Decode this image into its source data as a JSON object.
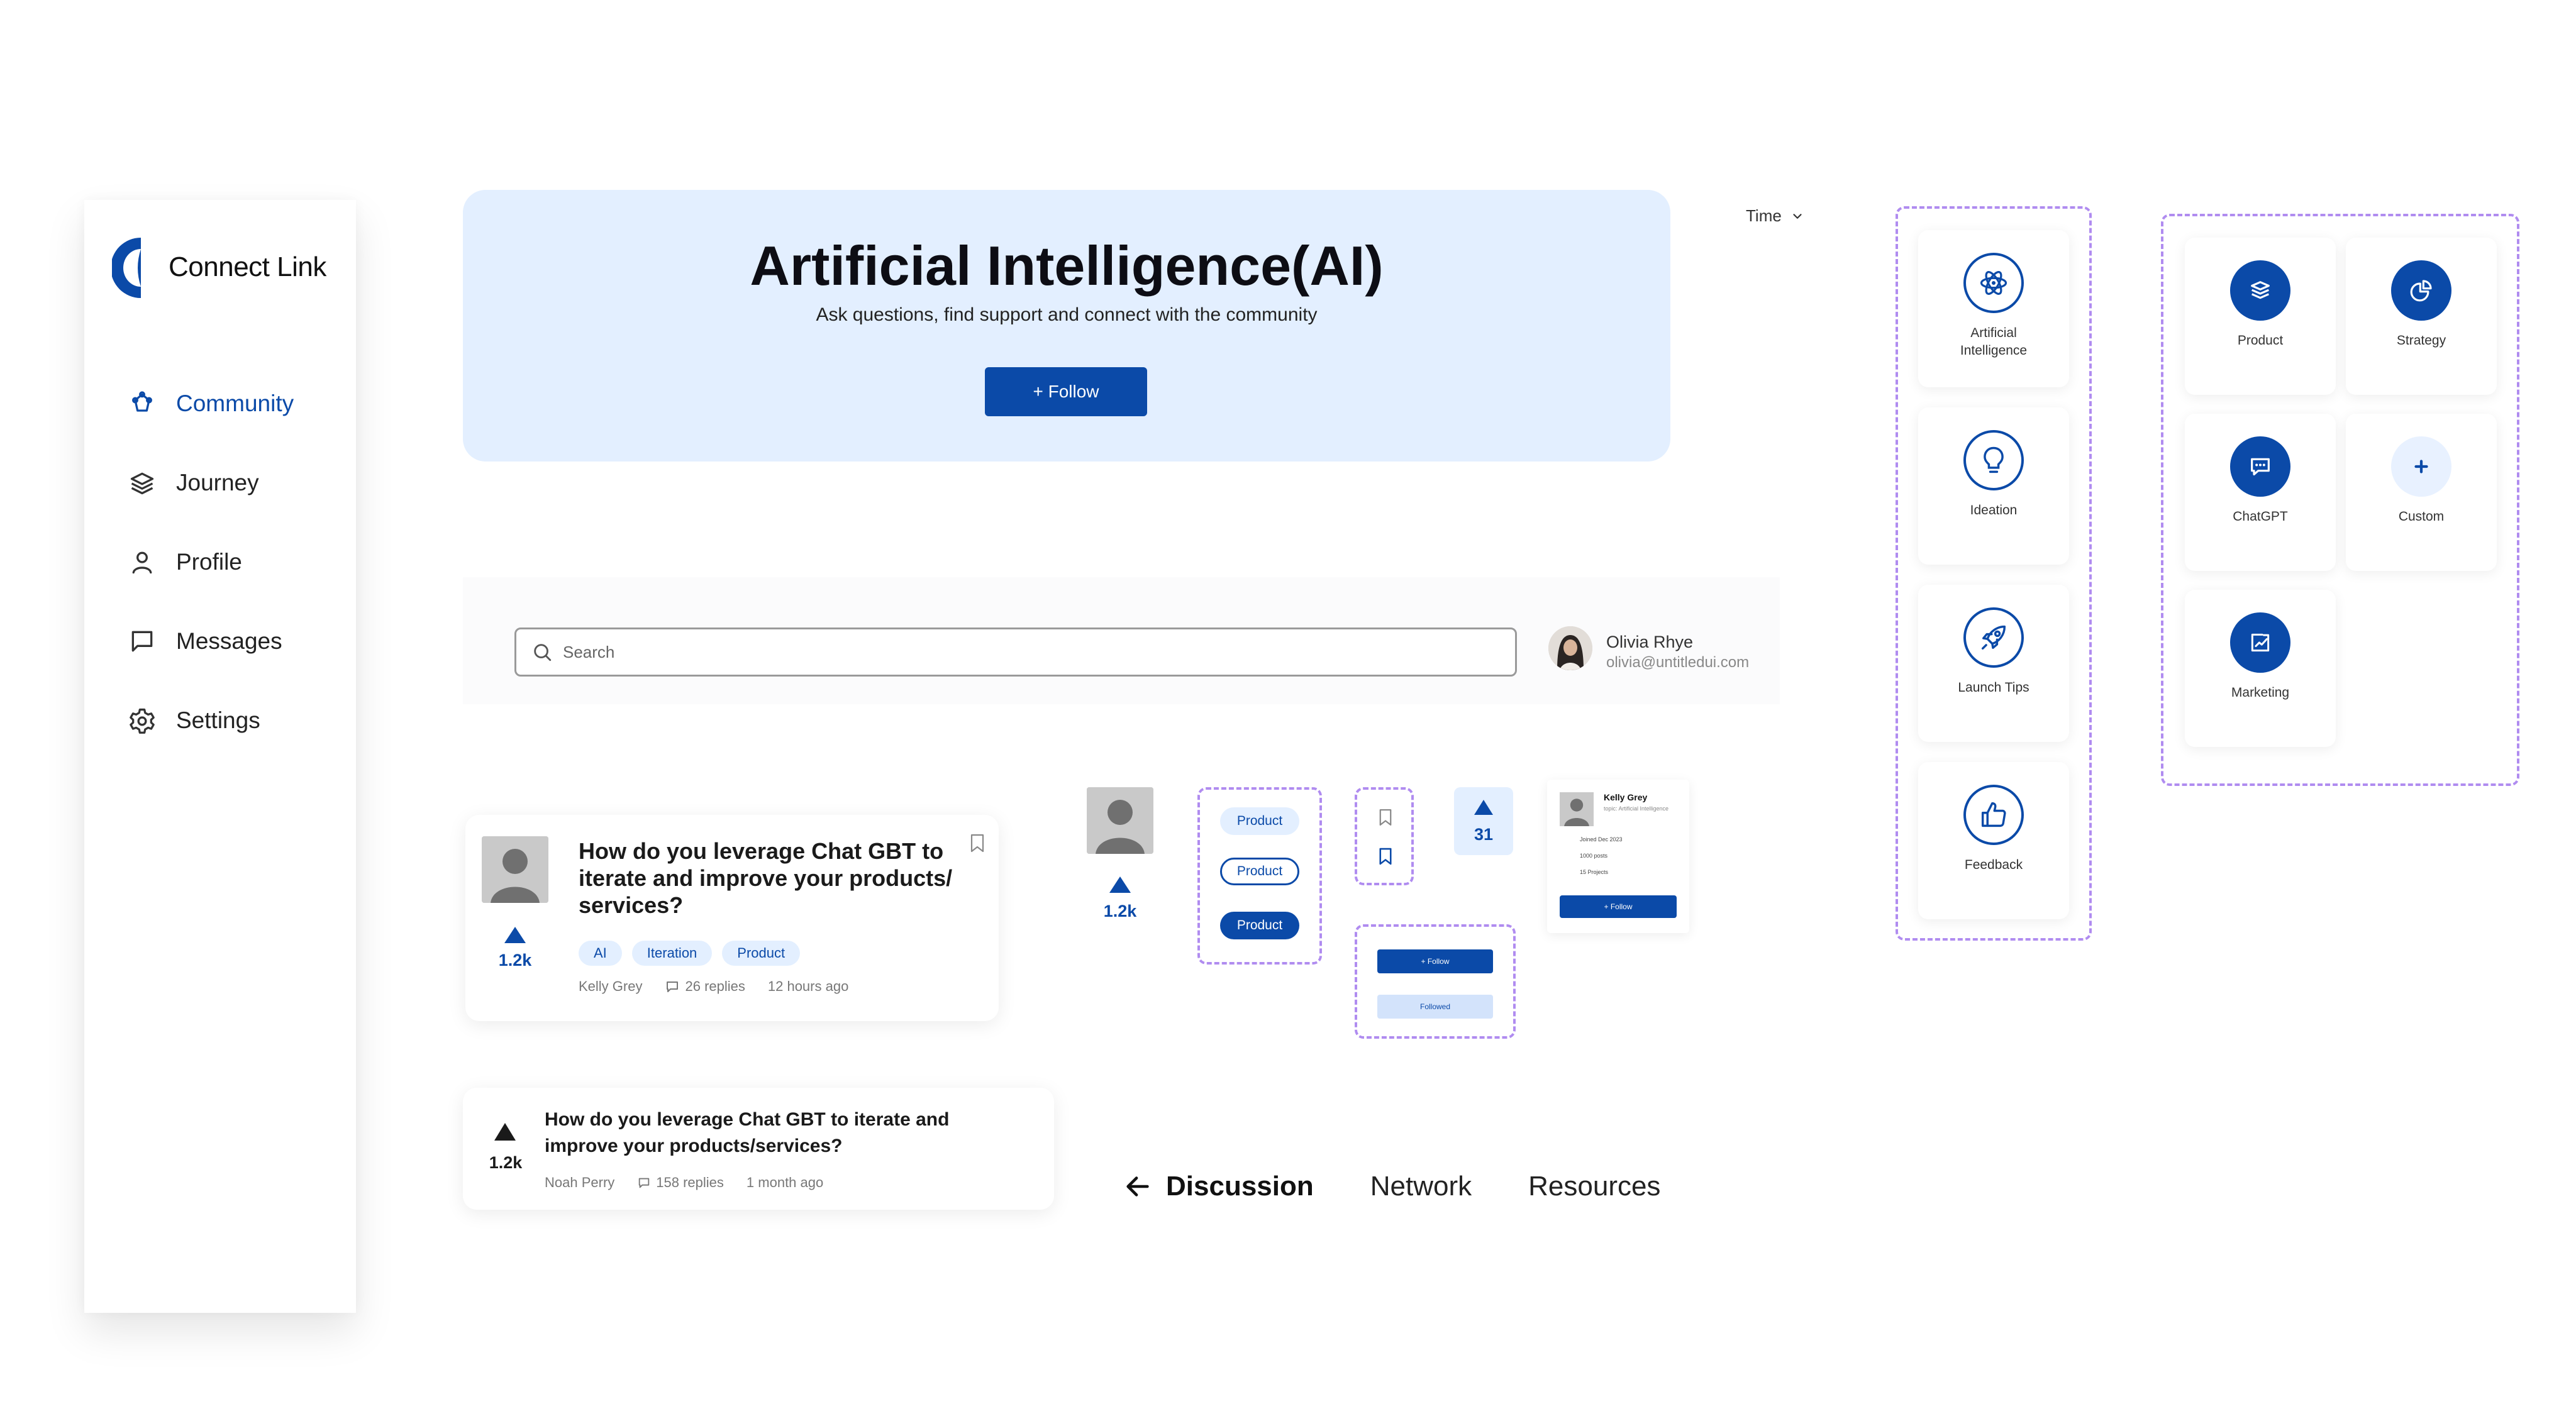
{
  "brand": {
    "name": "Connect Link",
    "color": "#0b4aa8"
  },
  "sidebar": {
    "items": [
      {
        "label": "Community",
        "icon": "community-icon",
        "active": true
      },
      {
        "label": "Journey",
        "icon": "layers-icon",
        "active": false
      },
      {
        "label": "Profile",
        "icon": "user-icon",
        "active": false
      },
      {
        "label": "Messages",
        "icon": "message-icon",
        "active": false
      },
      {
        "label": "Settings",
        "icon": "gear-icon",
        "active": false
      }
    ]
  },
  "hero": {
    "title": "Artificial Intelligence(AI)",
    "subtitle": "Ask questions, find support and connect with the community",
    "follow_label": "+ Follow"
  },
  "filter": {
    "label": "Time"
  },
  "search": {
    "placeholder": "Search"
  },
  "user": {
    "name": "Olivia Rhye",
    "email": "olivia@untitledui.com"
  },
  "question_card": {
    "title": "How do you leverage Chat GBT to iterate and improve your products/ services?",
    "votes": "1.2k",
    "tags": [
      "AI",
      "Iteration",
      "Product"
    ],
    "author": "Kelly Grey",
    "replies": "26 replies",
    "time": "12 hours ago"
  },
  "question_card_compact": {
    "title": "How do you leverage Chat GBT to iterate and improve your products/services?",
    "votes": "1.2k",
    "author": "Noah Perry",
    "replies": "158 replies",
    "time": "1 month ago"
  },
  "tabs": {
    "active": "Discussion",
    "items": [
      "Network",
      "Resources"
    ]
  },
  "components": {
    "avatar_votes": "1.2k",
    "pills": [
      "Product",
      "Product",
      "Product"
    ],
    "vote_count": "31",
    "follow_small": "+ Follow",
    "followed_small": "Followed",
    "profile_card": {
      "name": "Kelly Grey",
      "topic": "topic: Artificial Intelligence",
      "joined": "Joined Dec 2023",
      "posts": "1000 posts",
      "projects": "15 Projects",
      "follow": "+ Follow"
    }
  },
  "categories_outline": [
    {
      "label": "Artificial Intelligence",
      "icon": "atom-icon"
    },
    {
      "label": "Ideation",
      "icon": "lightbulb-icon"
    },
    {
      "label": "Launch Tips",
      "icon": "rocket-icon"
    },
    {
      "label": "Feedback",
      "icon": "thumbs-up-icon"
    }
  ],
  "categories_solid": [
    {
      "label": "Product",
      "icon": "layers-icon"
    },
    {
      "label": "Strategy",
      "icon": "pie-chart-icon"
    },
    {
      "label": "ChatGPT",
      "icon": "chat-icon"
    },
    {
      "label": "Custom",
      "icon": "plus-icon"
    },
    {
      "label": "Marketing",
      "icon": "growth-chart-icon"
    }
  ]
}
